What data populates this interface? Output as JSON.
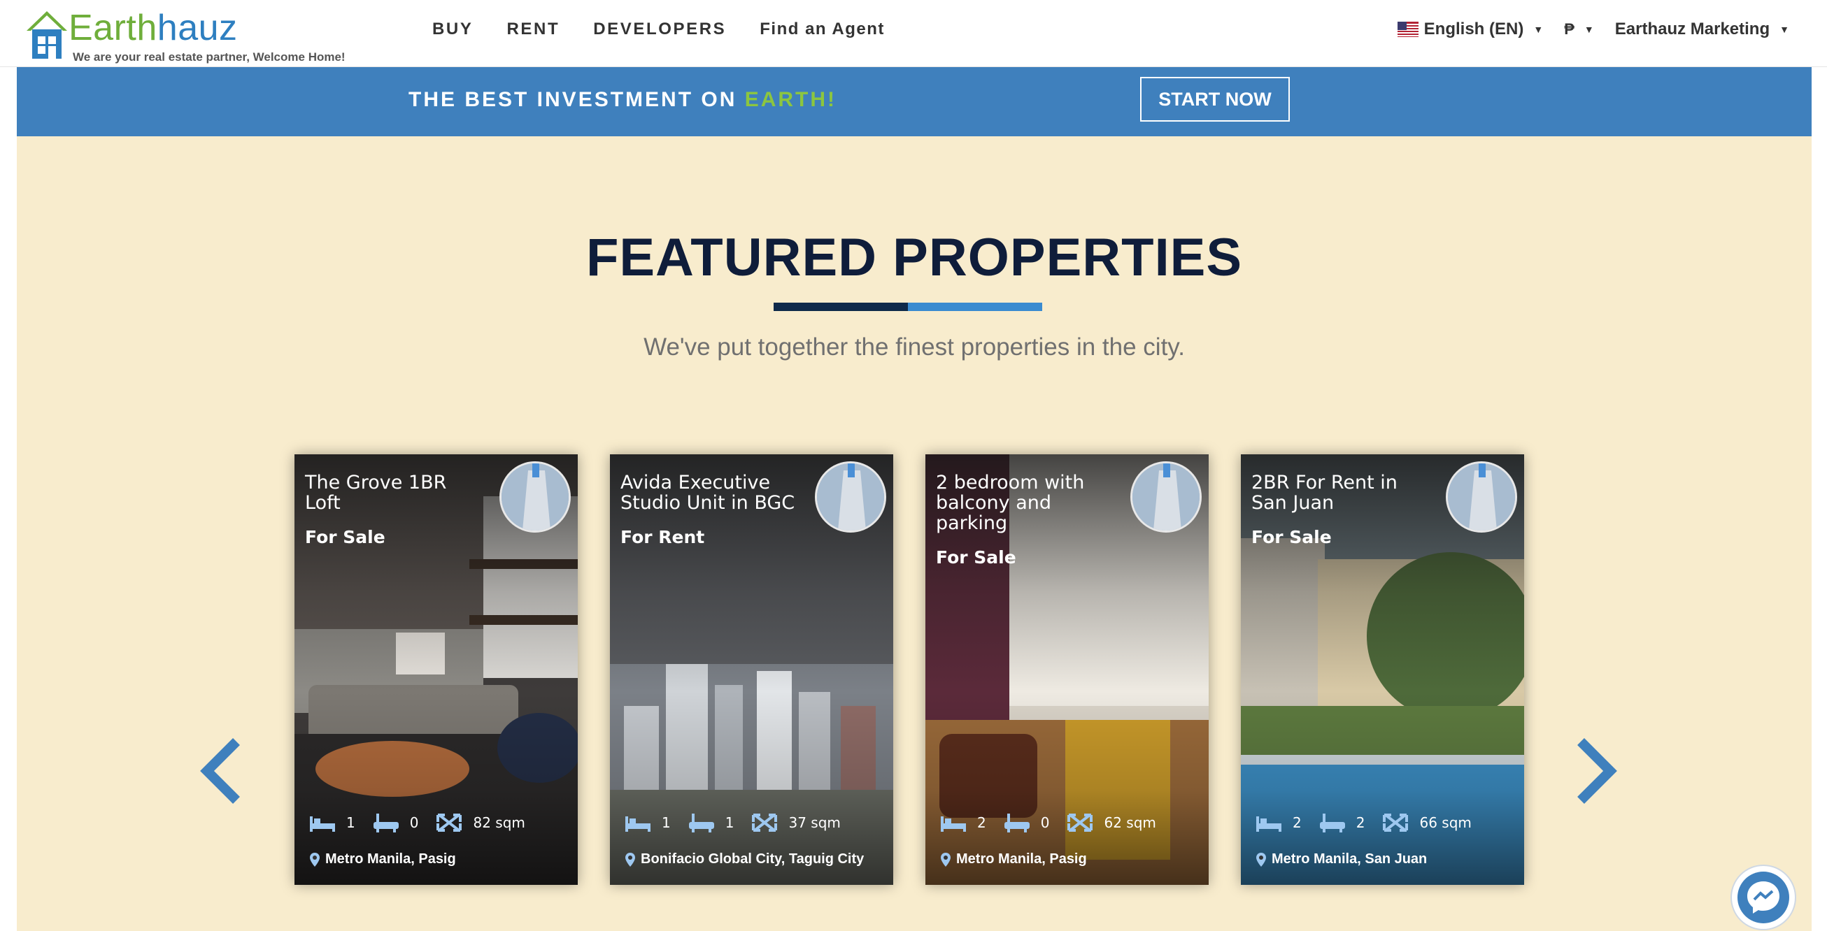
{
  "header": {
    "logo": {
      "name_part1": "Earth",
      "name_part2": "auz",
      "tagline": "We are your real estate partner, Welcome Home!"
    },
    "nav": [
      "BUY",
      "RENT",
      "DEVELOPERS",
      "Find an Agent"
    ],
    "language": "English (EN)",
    "currency_icon": "peso-icon",
    "account": "Earthauz Marketing"
  },
  "banner": {
    "text_main": "THE BEST INVESTMENT ON ",
    "text_accent": "EARTH!",
    "cta": "START NOW"
  },
  "featured": {
    "title": "FEATURED PROPERTIES",
    "subtitle": "We've put together the finest properties in the city.",
    "cards": [
      {
        "title": "The Grove 1BR Loft",
        "status": "For Sale",
        "beds": "1",
        "baths": "0",
        "area": "82 sqm",
        "location": "Metro Manila, Pasig"
      },
      {
        "title": "Avida Executive Studio Unit in BGC",
        "status": "For Rent",
        "beds": "1",
        "baths": "1",
        "area": "37 sqm",
        "location": "Bonifacio Global City, Taguig City"
      },
      {
        "title": "2 bedroom with balcony and parking",
        "status": "For Sale",
        "beds": "2",
        "baths": "0",
        "area": "62 sqm",
        "location": "Metro Manila, Pasig"
      },
      {
        "title": "2BR For Rent in San Juan",
        "status": "For Sale",
        "beds": "2",
        "baths": "2",
        "area": "66 sqm",
        "location": "Metro Manila, San Juan"
      }
    ]
  },
  "colors": {
    "banner_blue": "#3f80bd",
    "accent_green": "#8cc63f",
    "section_bg": "#f8eccd",
    "title_navy": "#0f1d3a"
  }
}
